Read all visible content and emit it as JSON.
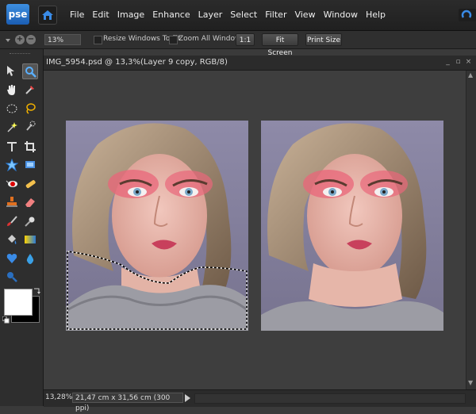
{
  "app": {
    "logo_text": "pse",
    "accent": "#2a7ad5"
  },
  "menu": [
    "File",
    "Edit",
    "Image",
    "Enhance",
    "Layer",
    "Select",
    "Filter",
    "View",
    "Window",
    "Help"
  ],
  "options": {
    "zoom_value": "13%",
    "resize_windows_label": "Resize Windows To Fit",
    "zoom_all_windows_label": "Zoom All Windows",
    "actual_pixels_label": "1:1",
    "fit_screen_label": "Fit Screen",
    "print_size_label": "Print Size"
  },
  "tools": [
    "move-tool",
    "zoom-tool",
    "hand-tool",
    "eyedropper-tool",
    "marquee-tool",
    "lasso-tool",
    "magic-wand-tool",
    "quick-selection-tool",
    "type-tool",
    "crop-tool",
    "cookie-cutter-tool",
    "straighten-tool",
    "red-eye-tool",
    "spot-healing-tool",
    "clone-stamp-tool",
    "eraser-tool",
    "brush-tool",
    "smart-brush-tool",
    "paint-bucket-tool",
    "gradient-tool",
    "custom-shape-tool",
    "blur-tool",
    "sponge-tool"
  ],
  "colors": {
    "foreground": "#ffffff",
    "background": "#000000"
  },
  "document": {
    "title": "IMG_5954.psd @ 13,3%(Layer 9 copy, RGB/8)",
    "status_zoom": "13,28%",
    "doc_size": "21,47 cm x 31,56 cm (300 ppi)"
  }
}
